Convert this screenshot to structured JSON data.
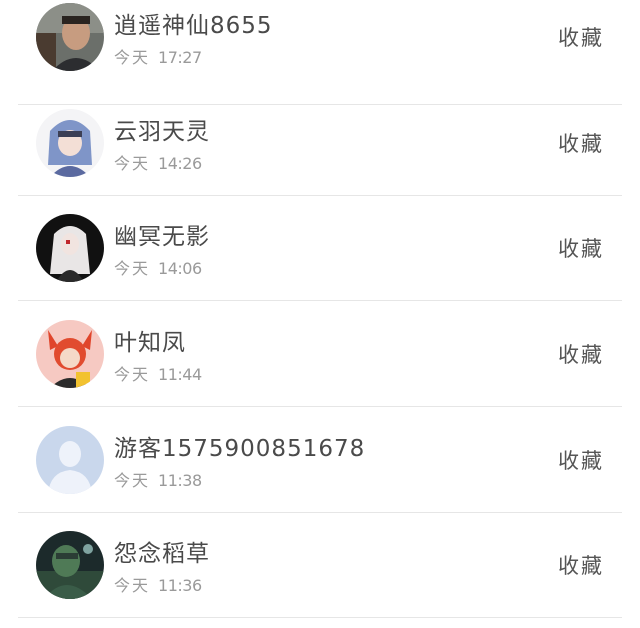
{
  "messages": [
    {
      "name": "逍遥神仙8655",
      "day": "今天",
      "time": "17:27",
      "action": "收藏",
      "avatar": "avatar-man-photo"
    },
    {
      "name": "云羽天灵",
      "day": "今天",
      "time": "14:26",
      "action": "收藏",
      "avatar": "avatar-anime-blue-hair"
    },
    {
      "name": "幽冥无影",
      "day": "今天",
      "time": "14:06",
      "action": "收藏",
      "avatar": "avatar-anime-dark"
    },
    {
      "name": "叶知凤",
      "day": "今天",
      "time": "11:44",
      "action": "收藏",
      "avatar": "avatar-anime-red-hair"
    },
    {
      "name": "游客1575900851678",
      "day": "今天",
      "time": "11:38",
      "action": "收藏",
      "avatar": "avatar-default-silhouette"
    },
    {
      "name": "怨念稻草",
      "day": "今天",
      "time": "11:36",
      "action": "收藏",
      "avatar": "avatar-game-dark-green"
    }
  ]
}
